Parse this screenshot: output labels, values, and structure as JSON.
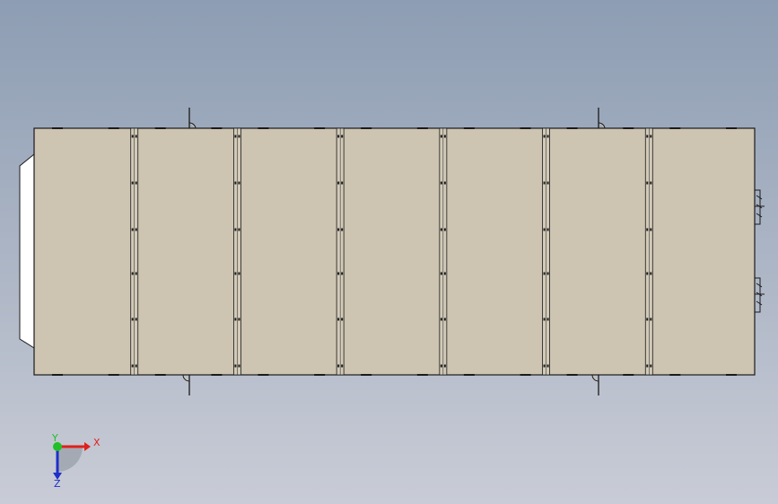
{
  "viewport": {
    "background_top": "#8d9db3",
    "background_bottom": "#c9ccd6"
  },
  "model": {
    "panel_fill": "#cdc4b1",
    "edge_color": "#1a1a1a",
    "rail_fill": "#d2cab8",
    "end_cap_fill": "#ffffff",
    "panel_count": 7
  },
  "triad": {
    "x_label": "X",
    "y_label": "Y",
    "z_label": "Z",
    "x_color": "#e0201c",
    "y_color": "#21c026",
    "z_color": "#1f2fc8",
    "origin_color": "#9aa0aa"
  }
}
